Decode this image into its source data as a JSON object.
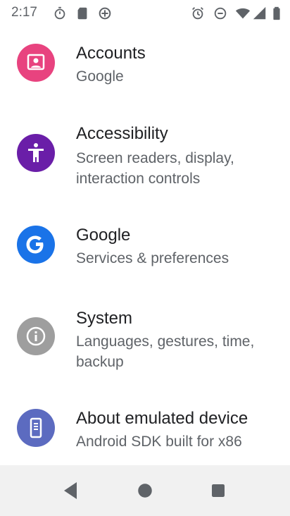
{
  "status": {
    "time": "2:17"
  },
  "settings": {
    "items": [
      {
        "title": "Accounts",
        "subtitle": "Google",
        "icon": "accounts-icon",
        "color": "#e8437f"
      },
      {
        "title": "Accessibility",
        "subtitle": "Screen readers, display, interaction controls",
        "icon": "accessibility-icon",
        "color": "#6a1ea8"
      },
      {
        "title": "Google",
        "subtitle": "Services & preferences",
        "icon": "google-icon",
        "color": "#1a73e8"
      },
      {
        "title": "System",
        "subtitle": "Languages, gestures, time, backup",
        "icon": "info-icon",
        "color": "#9e9e9e"
      },
      {
        "title": "About emulated device",
        "subtitle": "Android SDK built for x86",
        "icon": "phone-icon",
        "color": "#5c6bc0"
      }
    ]
  },
  "nav": {
    "back": "back-icon",
    "home": "home-icon",
    "recents": "recents-icon"
  }
}
